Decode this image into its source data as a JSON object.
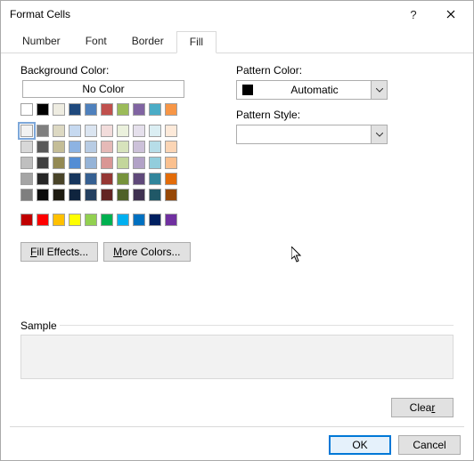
{
  "window": {
    "title": "Format Cells"
  },
  "tabs": {
    "number": "Number",
    "font": "Font",
    "border": "Border",
    "fill": "Fill"
  },
  "fill": {
    "bg_label": "Background Color:",
    "no_color": "No Color",
    "fill_effects": "Fill Effects...",
    "more_colors": "More Colors...",
    "pattern_color_label": "Pattern Color:",
    "pattern_color_value": "Automatic",
    "pattern_style_label": "Pattern Style:",
    "pattern_style_value": ""
  },
  "colors": {
    "main_row1": [
      "#ffffff",
      "#000000",
      "#eeece1",
      "#1f497d",
      "#4f81bd",
      "#c0504d",
      "#9bbb59",
      "#8064a2",
      "#4bacc6",
      "#f79646"
    ],
    "theme_grid": [
      [
        "#f2f2f2",
        "#7f7f7f",
        "#ddd9c3",
        "#c6d9f0",
        "#dbe5f1",
        "#f2dcdb",
        "#ebf1dd",
        "#e5e0ec",
        "#dbeef3",
        "#fdeada"
      ],
      [
        "#d8d8d8",
        "#595959",
        "#c4bd97",
        "#8db3e2",
        "#b8cce4",
        "#e5b9b7",
        "#d7e3bc",
        "#ccc1d9",
        "#b7dde8",
        "#fbd5b5"
      ],
      [
        "#bfbfbf",
        "#3f3f3f",
        "#938953",
        "#548dd4",
        "#95b3d7",
        "#d99694",
        "#c3d69b",
        "#b2a2c7",
        "#92cddc",
        "#fac08f"
      ],
      [
        "#a5a5a5",
        "#262626",
        "#494429",
        "#17365d",
        "#366092",
        "#953734",
        "#76923c",
        "#5f497a",
        "#31859b",
        "#e36c09"
      ],
      [
        "#7f7f7f",
        "#0c0c0c",
        "#1d1b10",
        "#0f243e",
        "#244061",
        "#632423",
        "#4f6128",
        "#3f3151",
        "#205867",
        "#974806"
      ]
    ],
    "standard": [
      "#c00000",
      "#ff0000",
      "#ffc000",
      "#ffff00",
      "#92d050",
      "#00b050",
      "#00b0f0",
      "#0070c0",
      "#002060",
      "#7030a0"
    ]
  },
  "sample": {
    "label": "Sample"
  },
  "buttons": {
    "clear": "Clear",
    "ok": "OK",
    "cancel": "Cancel"
  }
}
